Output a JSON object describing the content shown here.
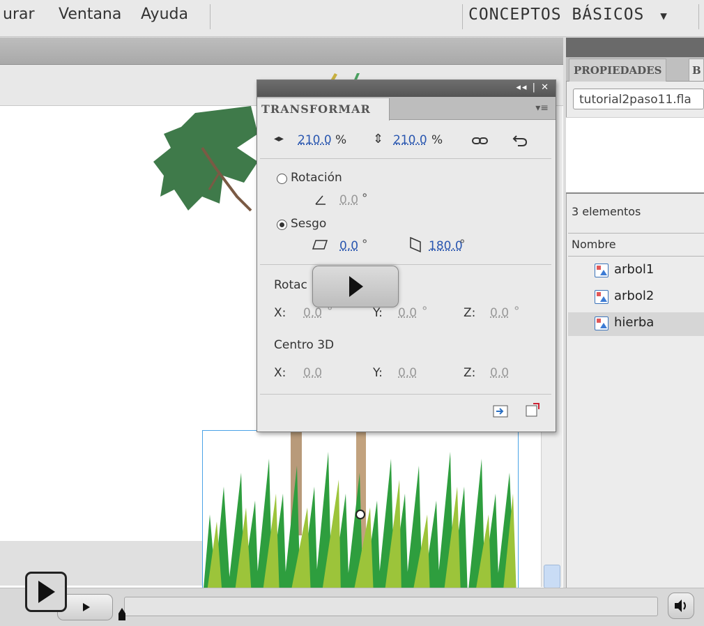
{
  "menu": {
    "items": [
      "urar",
      "Ventana",
      "Ayuda"
    ],
    "workspace": "CONCEPTOS BÁSICOS",
    "workspace_arrow": "▼"
  },
  "right_panel": {
    "tabs": [
      "PROPIEDADES",
      "B"
    ],
    "file_name": "tutorial2paso11.fla",
    "item_count": "3 elementos",
    "column_name": "Nombre",
    "items": [
      {
        "label": "arbol1",
        "selected": false
      },
      {
        "label": "arbol2",
        "selected": false
      },
      {
        "label": "hierba",
        "selected": true
      }
    ]
  },
  "transform_panel": {
    "title": "TRANSFORMAR",
    "window_controls": "◂◂ | ✕",
    "menu_icon": "▾≡",
    "scale_width": "210.0",
    "scale_height": "210.0",
    "percent_sign": "%",
    "rotation_label": "Rotación",
    "rotation_value": "0.0",
    "skew_label": "Sesgo",
    "skew_h": "0.0",
    "skew_v": "180.0",
    "degree": "°",
    "rot3d_label": "Rotac",
    "rot3d": {
      "x_label": "X:",
      "x": "0.0",
      "y_label": "Y:",
      "y": "0.0",
      "z_label": "Z:",
      "z": "0.0"
    },
    "center3d_label": "Centro 3D",
    "center3d": {
      "x_label": "X:",
      "x": "0.0",
      "y_label": "Y:",
      "y": "0.0",
      "z_label": "Z:",
      "z": "0.0"
    }
  },
  "icons": [
    "scale-width-icon",
    "scale-height-icon",
    "constrain-link-icon",
    "reset-icon",
    "rotate-angle-icon",
    "skew-horizontal-icon",
    "skew-vertical-icon",
    "duplicate-transform-icon",
    "remove-transform-icon",
    "play-icon",
    "volume-icon"
  ],
  "colors": {
    "link_value": "#2a57b0",
    "grass_dark": "#2e9e3e",
    "grass_light": "#9cc43a",
    "tree_leaves": "#3f7a4a",
    "selection": "#4aa3e6"
  }
}
